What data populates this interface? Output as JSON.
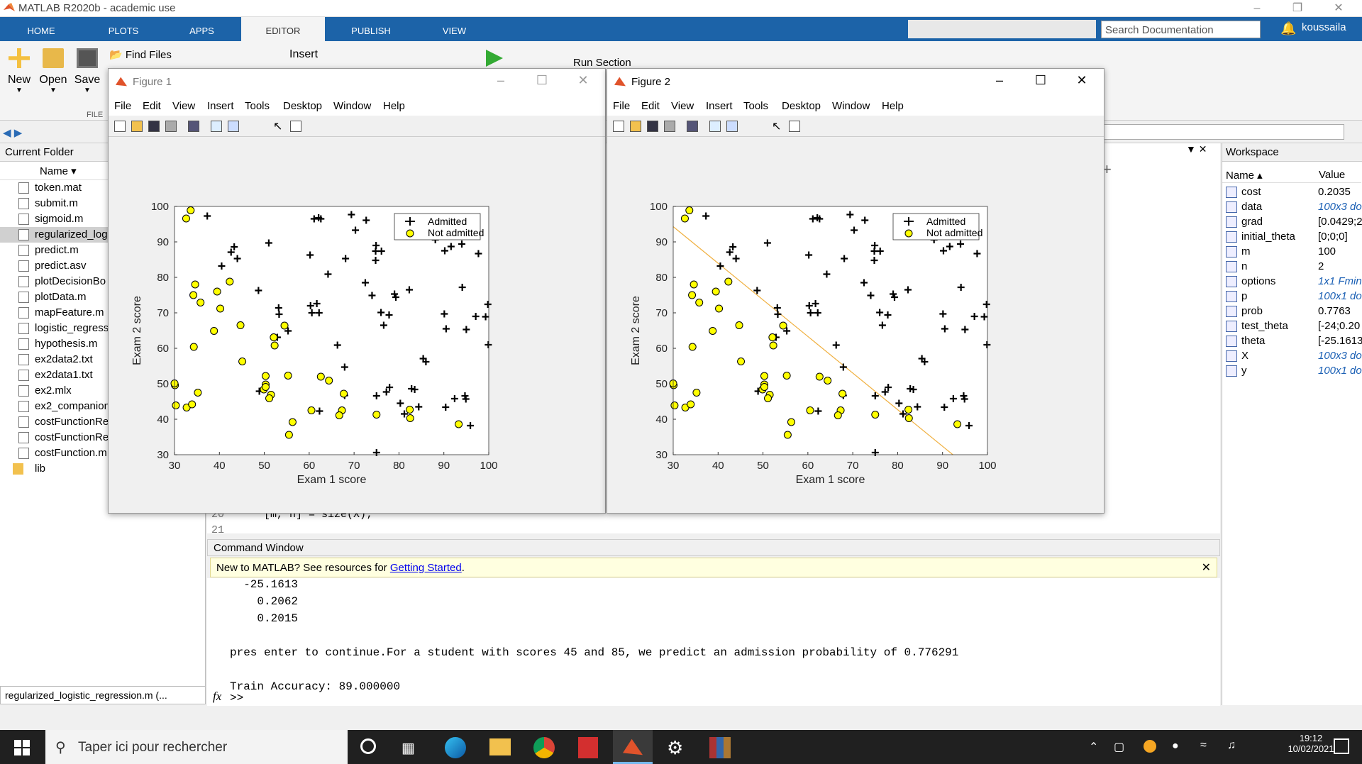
{
  "app": {
    "title": "MATLAB R2020b - academic use",
    "user": "koussaila",
    "search_placeholder": "Search Documentation"
  },
  "ribbon": {
    "tabs": [
      "HOME",
      "PLOTS",
      "APPS",
      "EDITOR",
      "PUBLISH",
      "VIEW"
    ],
    "active": "EDITOR",
    "new_label": "New",
    "open_label": "Open",
    "save_label": "Save",
    "find_files_label": "Find Files",
    "insert_label": "Insert",
    "run_section_label": "Run Section",
    "file_group_label": "FILE"
  },
  "current_folder": {
    "title": "Current Folder",
    "name_col": "Name ▾",
    "files": [
      "token.mat",
      "submit.m",
      "sigmoid.m",
      "regularized_log",
      "predict.m",
      "predict.asv",
      "plotDecisionBo",
      "plotData.m",
      "mapFeature.m",
      "logistic_regressi",
      "hypothesis.m",
      "ex2data2.txt",
      "ex2data1.txt",
      "ex2.mlx",
      "ex2_companion",
      "costFunctionReg",
      "costFunctionReg",
      "costFunction.m",
      "lib"
    ],
    "selected_index": 3,
    "bottom_file": "regularized_logistic_regression.m (..."
  },
  "editor": {
    "line20_num": "20",
    "line20_text": "[m, n] = size(X);",
    "line21_num": "21"
  },
  "command_window": {
    "title": "Command Window",
    "banner_text": "New to MATLAB? See resources for ",
    "banner_link": "Getting Started",
    "banner_end": ".",
    "lines": [
      "  -25.1613",
      "    0.2062",
      "    0.2015",
      "",
      "pres enter to continue.For a student with scores 45 and 85, we predict an admission probability of 0.776291",
      "",
      "Train Accuracy: 89.000000"
    ],
    "prompt": ">>",
    "fx": "fx"
  },
  "workspace": {
    "title": "Workspace",
    "name_col": "Name ▴",
    "value_col": "Value",
    "vars": [
      {
        "name": "cost",
        "value": "0.2035",
        "italic": false
      },
      {
        "name": "data",
        "value": "100x3 do",
        "italic": true
      },
      {
        "name": "grad",
        "value": "[0.0429;2",
        "italic": false
      },
      {
        "name": "initial_theta",
        "value": "[0;0;0]",
        "italic": false
      },
      {
        "name": "m",
        "value": "100",
        "italic": false
      },
      {
        "name": "n",
        "value": "2",
        "italic": false
      },
      {
        "name": "options",
        "value": "1x1 Fmin",
        "italic": true
      },
      {
        "name": "p",
        "value": "100x1 do",
        "italic": true
      },
      {
        "name": "prob",
        "value": "0.7763",
        "italic": false
      },
      {
        "name": "test_theta",
        "value": "[-24;0.20",
        "italic": false
      },
      {
        "name": "theta",
        "value": "[-25.1613",
        "italic": false
      },
      {
        "name": "X",
        "value": "100x3 do",
        "italic": true
      },
      {
        "name": "y",
        "value": "100x1 do",
        "italic": true
      }
    ]
  },
  "figures": [
    {
      "title": "Figure 1",
      "menu": [
        "File",
        "Edit",
        "View",
        "Insert",
        "Tools",
        "Desktop",
        "Window",
        "Help"
      ]
    },
    {
      "title": "Figure 2",
      "menu": [
        "File",
        "Edit",
        "View",
        "Insert",
        "Tools",
        "Desktop",
        "Window",
        "Help"
      ]
    }
  ],
  "chart_data": [
    {
      "type": "scatter",
      "xlabel": "Exam 1 score",
      "ylabel": "Exam 2 score",
      "xlim": [
        30,
        100
      ],
      "ylim": [
        30,
        100
      ],
      "xticks": [
        "30",
        "40",
        "50",
        "60",
        "70",
        "80",
        "90",
        "100"
      ],
      "yticks": [
        "30",
        "40",
        "50",
        "60",
        "70",
        "80",
        "90",
        "100"
      ],
      "legend": "top-right",
      "series": [
        {
          "name": "Admitted",
          "marker": "plus",
          "color": "#000000"
        },
        {
          "name": "Not admitted",
          "marker": "circle",
          "color": "#ffff00"
        }
      ]
    },
    {
      "type": "scatter",
      "xlabel": "Exam 1 score",
      "ylabel": "Exam 2 score",
      "xlim": [
        30,
        100
      ],
      "ylim": [
        30,
        100
      ],
      "xticks": [
        "30",
        "40",
        "50",
        "60",
        "70",
        "80",
        "90",
        "100"
      ],
      "yticks": [
        "30",
        "40",
        "50",
        "60",
        "70",
        "80",
        "90",
        "100"
      ],
      "legend": "top-right",
      "series": [
        {
          "name": "Admitted",
          "marker": "plus",
          "color": "#000000"
        },
        {
          "name": "Not admitted",
          "marker": "circle",
          "color": "#ffff00"
        }
      ],
      "decision_boundary": {
        "x": [
          30,
          92.3
        ],
        "y": [
          94.3,
          30
        ],
        "color": "#f0b040"
      }
    }
  ],
  "points": {
    "admitted": [
      [
        60.2,
        86.3
      ],
      [
        79.0,
        75.3
      ],
      [
        61.1,
        96.5
      ],
      [
        75.0,
        46.6
      ],
      [
        76.1,
        87.4
      ],
      [
        84.4,
        43.5
      ],
      [
        95.9,
        38.2
      ],
      [
        75.0,
        30.6
      ],
      [
        82.3,
        76.5
      ],
      [
        69.4,
        97.7
      ],
      [
        52.9,
        63.1
      ],
      [
        94.1,
        77.2
      ],
      [
        90.4,
        43.4
      ],
      [
        79.3,
        74.4
      ],
      [
        62.2,
        70.0
      ],
      [
        77.2,
        47.7
      ],
      [
        97.7,
        86.7
      ],
      [
        62.1,
        96.8
      ],
      [
        91.6,
        88.7
      ],
      [
        99.8,
        72.4
      ],
      [
        74.8,
        87.4
      ],
      [
        86.0,
        56.2
      ],
      [
        76.0,
        70.1
      ],
      [
        70.3,
        93.3
      ],
      [
        51.0,
        89.7
      ],
      [
        68.1,
        85.3
      ],
      [
        80.3,
        44.5
      ],
      [
        97.1,
        69.0
      ],
      [
        67.9,
        54.7
      ],
      [
        60.3,
        72.0
      ],
      [
        85.4,
        57.1
      ],
      [
        74.9,
        89.0
      ],
      [
        64.2,
        80.9
      ],
      [
        88.1,
        90.6
      ],
      [
        94.7,
        46.6
      ],
      [
        95.0,
        65.3
      ],
      [
        55.3,
        64.9
      ],
      [
        61.7,
        72.6
      ],
      [
        99.3,
        68.9
      ],
      [
        62.6,
        96.5
      ],
      [
        76.6,
        66.5
      ],
      [
        48.7,
        76.3
      ],
      [
        53.3,
        69.6
      ],
      [
        90.5,
        65.5
      ],
      [
        72.5,
        78.5
      ],
      [
        82.8,
        48.6
      ],
      [
        77.8,
        69.4
      ],
      [
        92.4,
        45.8
      ],
      [
        99.9,
        61.0
      ],
      [
        67.9,
        46.7
      ],
      [
        83.5,
        48.4
      ],
      [
        60.6,
        70.0
      ],
      [
        94.9,
        45.7
      ],
      [
        43.3,
        88.6
      ],
      [
        90.2,
        87.5
      ],
      [
        48.9,
        47.9
      ],
      [
        42.6,
        87.1
      ],
      [
        81.2,
        41.5
      ],
      [
        66.3,
        60.9
      ],
      [
        74.0,
        74.9
      ],
      [
        94.0,
        89.4
      ],
      [
        90.1,
        69.7
      ],
      [
        77.9,
        49.0
      ],
      [
        53.2,
        71.4
      ],
      [
        62.3,
        42.3
      ],
      [
        37.3,
        97.3
      ],
      [
        40.5,
        83.2
      ],
      [
        74.8,
        84.8
      ],
      [
        44.0,
        85.3
      ],
      [
        72.7,
        96.1
      ]
    ],
    "not_admitted": [
      [
        34.6,
        78.0
      ],
      [
        30.3,
        43.9
      ],
      [
        35.8,
        72.9
      ],
      [
        45.1,
        56.3
      ],
      [
        39.5,
        76.0
      ],
      [
        32.7,
        43.3
      ],
      [
        33.9,
        44.2
      ],
      [
        40.2,
        71.2
      ],
      [
        32.6,
        96.6
      ],
      [
        51.5,
        46.9
      ],
      [
        34.2,
        75.0
      ],
      [
        55.5,
        35.6
      ],
      [
        34.3,
        60.4
      ],
      [
        33.6,
        98.9
      ],
      [
        50.3,
        49.8
      ],
      [
        56.3,
        39.2
      ],
      [
        75.0,
        41.3
      ],
      [
        50.3,
        52.2
      ],
      [
        38.8,
        64.9
      ],
      [
        35.2,
        47.5
      ],
      [
        82.4,
        42.7
      ],
      [
        52.1,
        63.1
      ],
      [
        42.3,
        78.8
      ],
      [
        67.3,
        42.5
      ],
      [
        30.1,
        49.6
      ],
      [
        52.3,
        60.8
      ],
      [
        55.3,
        52.3
      ],
      [
        49.9,
        48.4
      ],
      [
        64.4,
        50.9
      ],
      [
        54.5,
        66.4
      ],
      [
        30.0,
        50.1
      ],
      [
        50.3,
        49.1
      ],
      [
        66.7,
        41.1
      ],
      [
        82.5,
        40.3
      ],
      [
        60.5,
        42.5
      ],
      [
        93.3,
        38.6
      ],
      [
        67.7,
        47.2
      ],
      [
        62.6,
        52.0
      ],
      [
        51.1,
        45.9
      ],
      [
        44.7,
        66.5
      ]
    ]
  }
}
